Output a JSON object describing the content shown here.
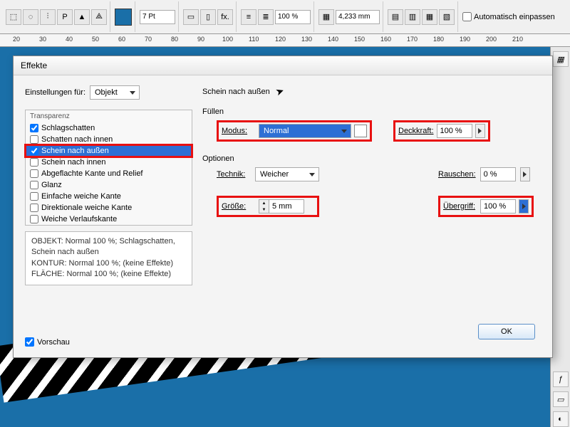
{
  "toolbar": {
    "stroke_weight": "7 Pt",
    "scale": "100 %",
    "width_field": "4,233 mm",
    "auto_fit_label": "Automatisch einpassen"
  },
  "ruler": {
    "marks": [
      20,
      30,
      40,
      50,
      60,
      70,
      80,
      90,
      100,
      110,
      120,
      130,
      140,
      150,
      160,
      170,
      180,
      190,
      200,
      210
    ]
  },
  "dialog": {
    "title": "Effekte",
    "settings_for_label": "Einstellungen für:",
    "settings_for_value": "Objekt",
    "transparency_label": "Transparenz",
    "effects": [
      {
        "label": "Schlagschatten",
        "checked": true,
        "selected": false
      },
      {
        "label": "Schatten nach innen",
        "checked": false,
        "selected": false
      },
      {
        "label": "Schein nach außen",
        "checked": true,
        "selected": true
      },
      {
        "label": "Schein nach innen",
        "checked": false,
        "selected": false
      },
      {
        "label": "Abgeflachte Kante und Relief",
        "checked": false,
        "selected": false
      },
      {
        "label": "Glanz",
        "checked": false,
        "selected": false
      },
      {
        "label": "Einfache weiche Kante",
        "checked": false,
        "selected": false
      },
      {
        "label": "Direktionale weiche Kante",
        "checked": false,
        "selected": false
      },
      {
        "label": "Weiche Verlaufskante",
        "checked": false,
        "selected": false
      }
    ],
    "summary": {
      "l1": "OBJEKT: Normal 100 %; Schlagschatten, Schein nach außen",
      "l2": "KONTUR: Normal 100 %; (keine Effekte)",
      "l3": "FLÄCHE: Normal 100 %; (keine Effekte)"
    },
    "preview_label": "Vorschau",
    "section_title": "Schein nach außen",
    "fill_label": "Füllen",
    "mode_label": "Modus:",
    "mode_value": "Normal",
    "opacity_label": "Deckkraft:",
    "opacity_value": "100 %",
    "options_label": "Optionen",
    "technique_label": "Technik:",
    "technique_value": "Weicher",
    "noise_label": "Rauschen:",
    "noise_value": "0 %",
    "size_label": "Größe:",
    "size_value": "5 mm",
    "spread_label": "Übergriff:",
    "spread_value": "100 %",
    "ok_label": "OK"
  }
}
